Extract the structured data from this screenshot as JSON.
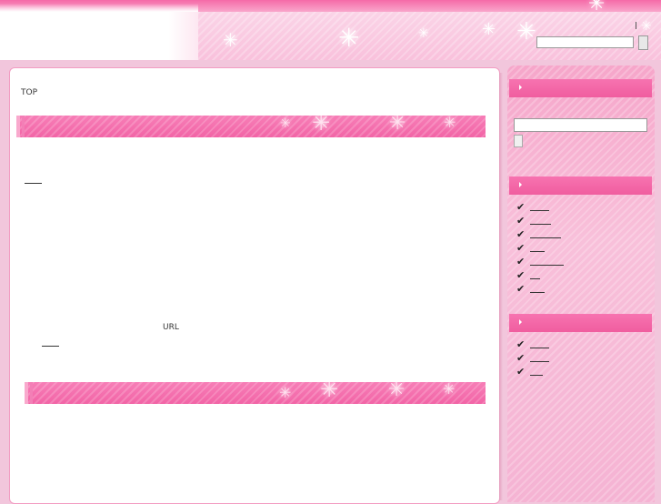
{
  "breadcrumb": {
    "top_label": "TOP"
  },
  "content": {
    "url_label": "URL"
  },
  "sidebar": {
    "sections": [
      {
        "name": "search"
      },
      {
        "name": "links",
        "items": 7
      },
      {
        "name": "more_links",
        "items": 3
      }
    ]
  },
  "colors": {
    "accent_pink": "#f264a6",
    "header_strip": "#f56aa8",
    "sidebar_bg": "#f8c0da",
    "content_border": "#f29cc2"
  },
  "icons": {
    "header_sparkle": "sparkle-icon",
    "section_arrow": "arrow-right-icon",
    "list_bullet": "check-icon"
  }
}
